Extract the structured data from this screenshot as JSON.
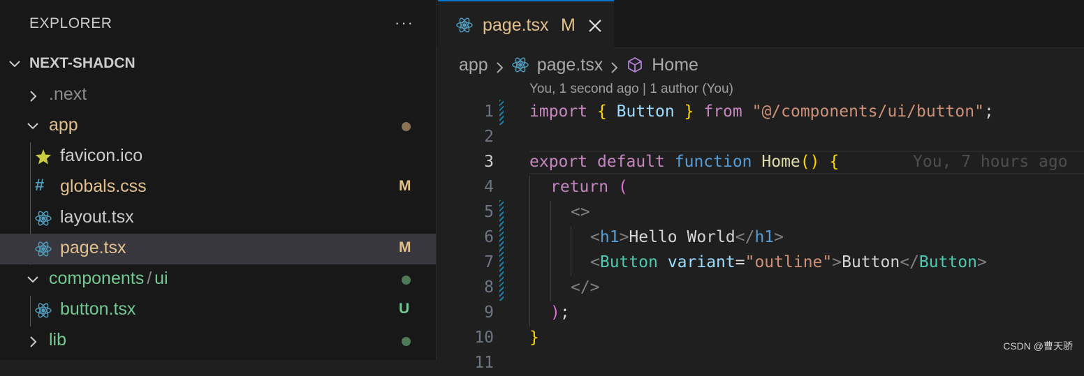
{
  "sidebar": {
    "header": "EXPLORER",
    "more": "···",
    "root": "NEXT-SHADCN",
    "items": [
      {
        "label": ".next"
      },
      {
        "label": "app"
      },
      {
        "label": "favicon.ico"
      },
      {
        "label": "globals.css",
        "badge": "M"
      },
      {
        "label": "layout.tsx"
      },
      {
        "label": "page.tsx",
        "badge": "M"
      },
      {
        "label": "components",
        "sep": "/",
        "sub": "ui"
      },
      {
        "label": "button.tsx",
        "badge": "U"
      },
      {
        "label": "lib"
      }
    ]
  },
  "colors": {
    "modified": "#e2c08d",
    "untracked": "#73c991",
    "accent": "#0078d4"
  },
  "tab": {
    "label": "page.tsx",
    "badge": "M"
  },
  "breadcrumb": {
    "folder": "app",
    "file": "page.tsx",
    "symbol": "Home"
  },
  "blame": {
    "header": "You, 1 second ago | 1 author (You)",
    "inline": "You, 7 hours ago"
  },
  "code": {
    "line_numbers": [
      "1",
      "2",
      "3",
      "4",
      "5",
      "6",
      "7",
      "8",
      "9",
      "10",
      "11"
    ],
    "l1": {
      "kw": "import",
      "ob": "{",
      "name": "Button",
      "cb": "}",
      "from": "from",
      "str": "\"@/components/ui/button\"",
      "semi": ";"
    },
    "l3": {
      "export": "export",
      "default": "default",
      "function": "function",
      "name": "Home",
      "parens": "()",
      "ob": "{"
    },
    "l4": {
      "kw": "return",
      "paren": "("
    },
    "l5": {
      "frag": "<>"
    },
    "l6": {
      "lt": "<",
      "tag": "h1",
      "gt": ">",
      "text": "Hello World",
      "close_lt": "</",
      "close_tag": "h1",
      "close_gt": ">"
    },
    "l7": {
      "lt": "<",
      "tag": "Button",
      "attr": "variant",
      "eq": "=",
      "val": "\"outline\"",
      "gt": ">",
      "text": "Button",
      "close_lt": "</",
      "close_tag": "Button",
      "close_gt": ">"
    },
    "l8": {
      "frag": "</>"
    },
    "l9": {
      "paren": ")",
      "semi": ";"
    },
    "l10": {
      "cb": "}"
    }
  },
  "watermark": "CSDN @曹天骄"
}
